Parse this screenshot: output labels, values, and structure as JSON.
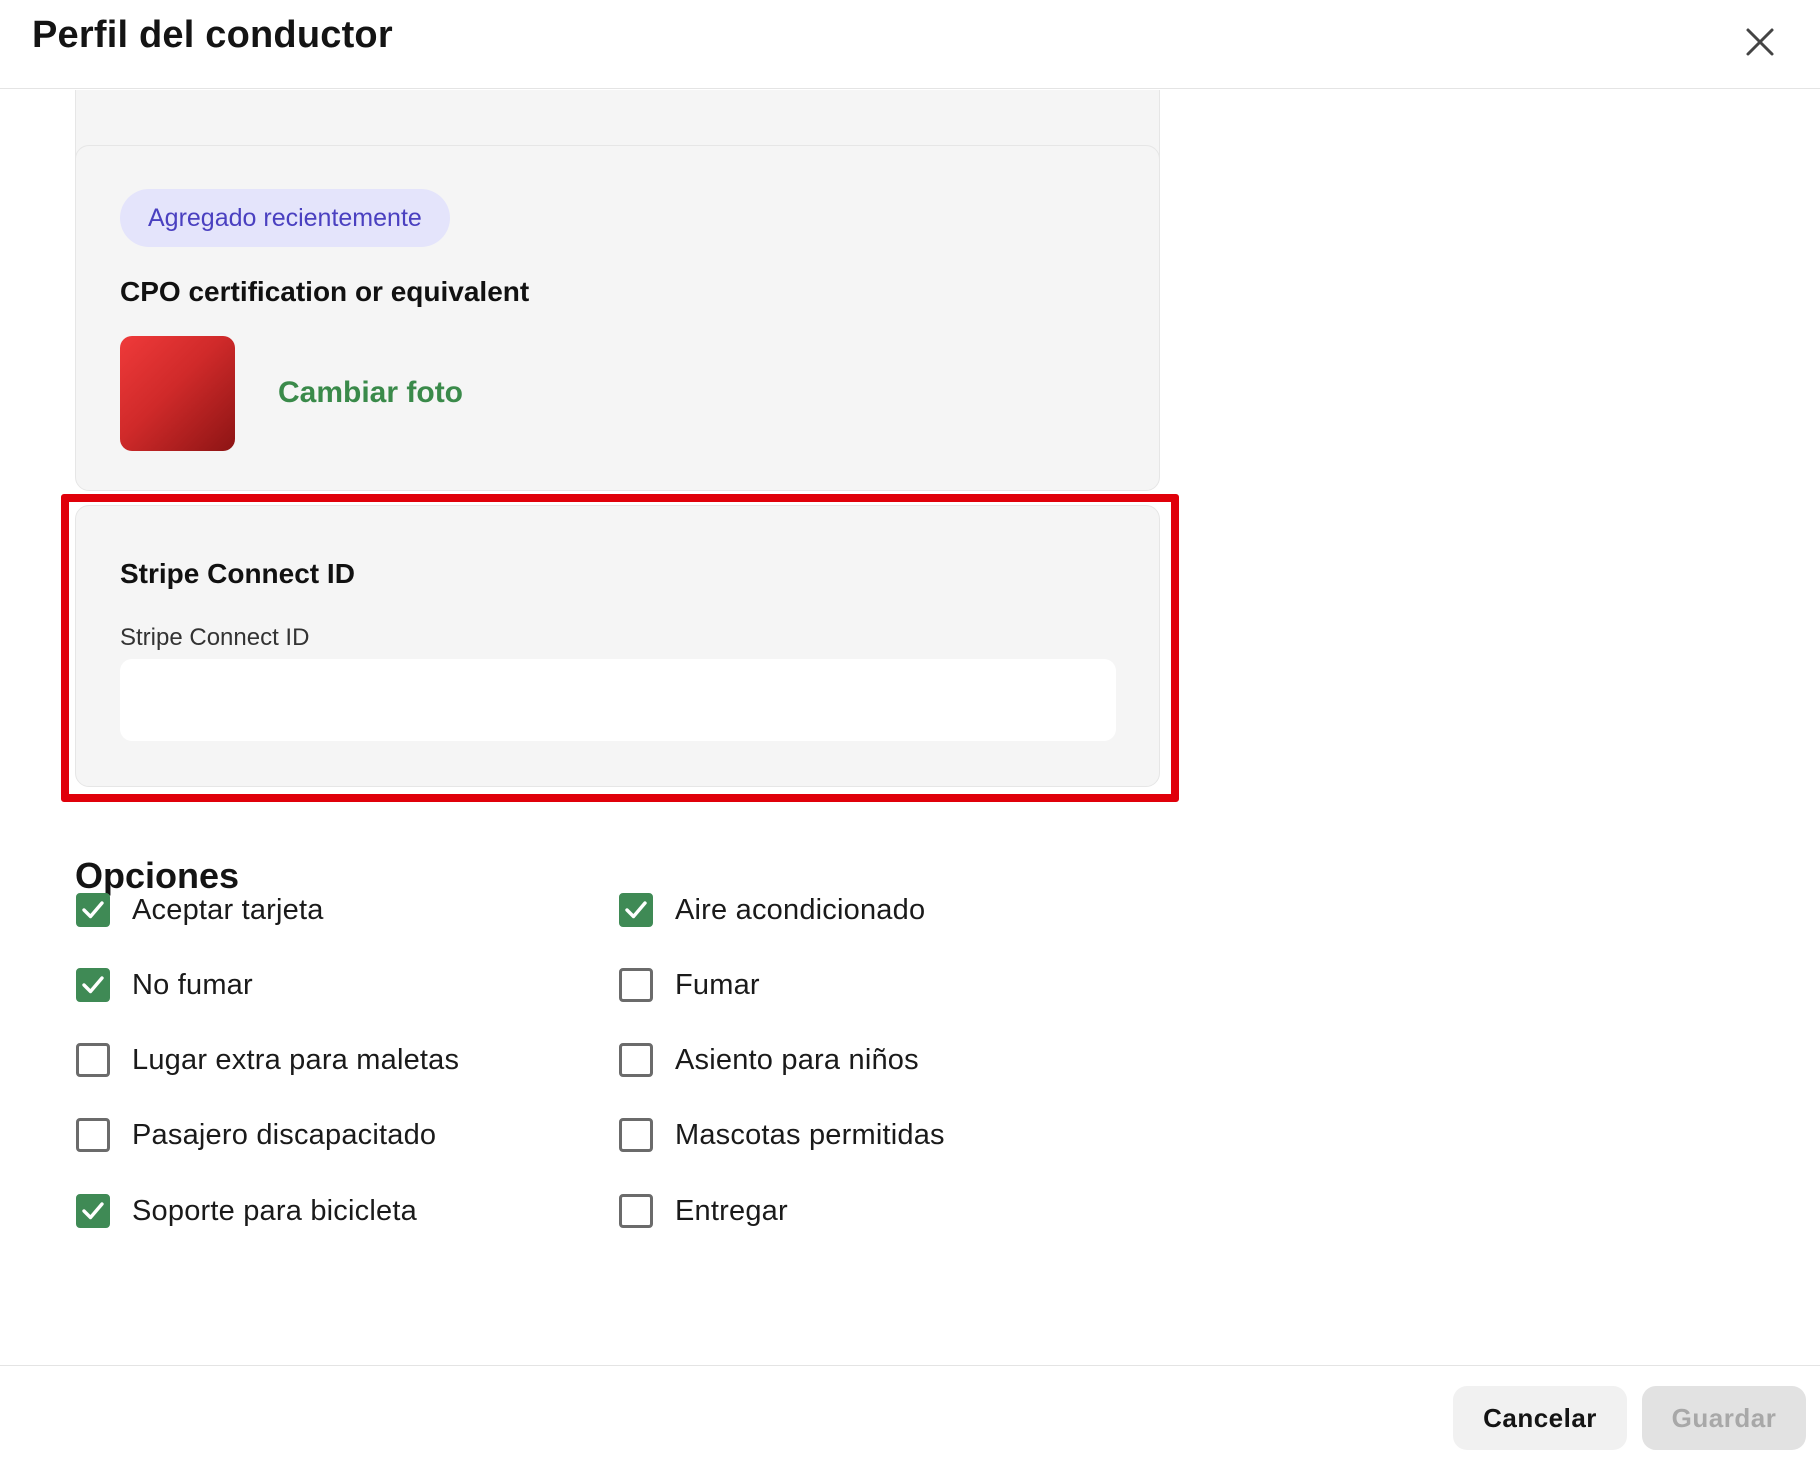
{
  "header": {
    "title": "Perfil del conductor",
    "close_icon": "close-icon"
  },
  "cpo_card": {
    "badge": "Agregado recientemente",
    "title": "CPO certification or equivalent",
    "change_photo": "Cambiar foto",
    "thumbnail_color": "#d02a2a"
  },
  "stripe_card": {
    "title": "Stripe Connect ID",
    "field_label": "Stripe Connect ID",
    "field_value": "",
    "highlight_color": "#e0000a"
  },
  "options": {
    "title": "Opciones",
    "check_color": "#3f8a55",
    "left_column": [
      {
        "label": "Aceptar tarjeta",
        "checked": true
      },
      {
        "label": "No fumar",
        "checked": true
      },
      {
        "label": "Lugar extra para maletas",
        "checked": false
      },
      {
        "label": "Pasajero discapacitado",
        "checked": false
      },
      {
        "label": "Soporte para bicicleta",
        "checked": true
      }
    ],
    "right_column": [
      {
        "label": "Aire acondicionado",
        "checked": true
      },
      {
        "label": "Fumar",
        "checked": false
      },
      {
        "label": "Asiento para niños",
        "checked": false
      },
      {
        "label": "Mascotas permitidas",
        "checked": false
      },
      {
        "label": "Entregar",
        "checked": false
      }
    ]
  },
  "footer": {
    "cancel_label": "Cancelar",
    "save_label": "Guardar"
  }
}
